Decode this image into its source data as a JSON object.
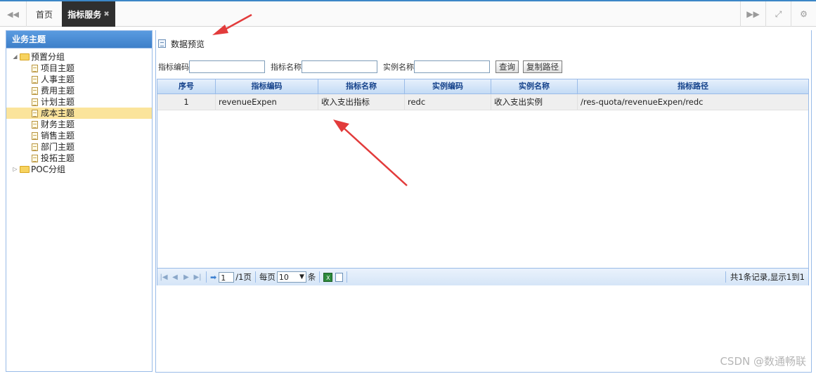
{
  "topbar": {
    "home_tab": "首页",
    "active_tab": "指标服务"
  },
  "sidebar": {
    "title": "业务主题",
    "tree": [
      {
        "label": "预置分组",
        "type": "folder",
        "expanded": true
      },
      {
        "label": "项目主题",
        "type": "doc"
      },
      {
        "label": "人事主题",
        "type": "doc"
      },
      {
        "label": "费用主题",
        "type": "doc"
      },
      {
        "label": "计划主题",
        "type": "doc"
      },
      {
        "label": "成本主题",
        "type": "doc",
        "selected": true
      },
      {
        "label": "财务主题",
        "type": "doc"
      },
      {
        "label": "销售主题",
        "type": "doc"
      },
      {
        "label": "部门主题",
        "type": "doc"
      },
      {
        "label": "投拓主题",
        "type": "doc"
      },
      {
        "label": "POC分组",
        "type": "folder",
        "expanded": false
      }
    ]
  },
  "main": {
    "panel_title": "数据预览",
    "search": {
      "code_label": "指标编码",
      "name_label": "指标名称",
      "instance_label": "实例名称",
      "query_btn": "查询",
      "copy_btn": "复制路径"
    },
    "table": {
      "columns": [
        "序号",
        "指标编码",
        "指标名称",
        "实例编码",
        "实例名称",
        "指标路径"
      ],
      "rows": [
        {
          "no": "1",
          "code": "revenueExpen",
          "name": "收入支出指标",
          "inst_code": "redc",
          "inst_name": "收入支出实例",
          "path": "/res-quota/revenueExpen/redc"
        }
      ]
    },
    "pager": {
      "page": "1",
      "page_total": "/1页",
      "per_page_label": "每页",
      "per_page": "10",
      "unit": "条",
      "info": "共1条记录,显示1到1"
    }
  },
  "watermark": "CSDN @数通畅联"
}
